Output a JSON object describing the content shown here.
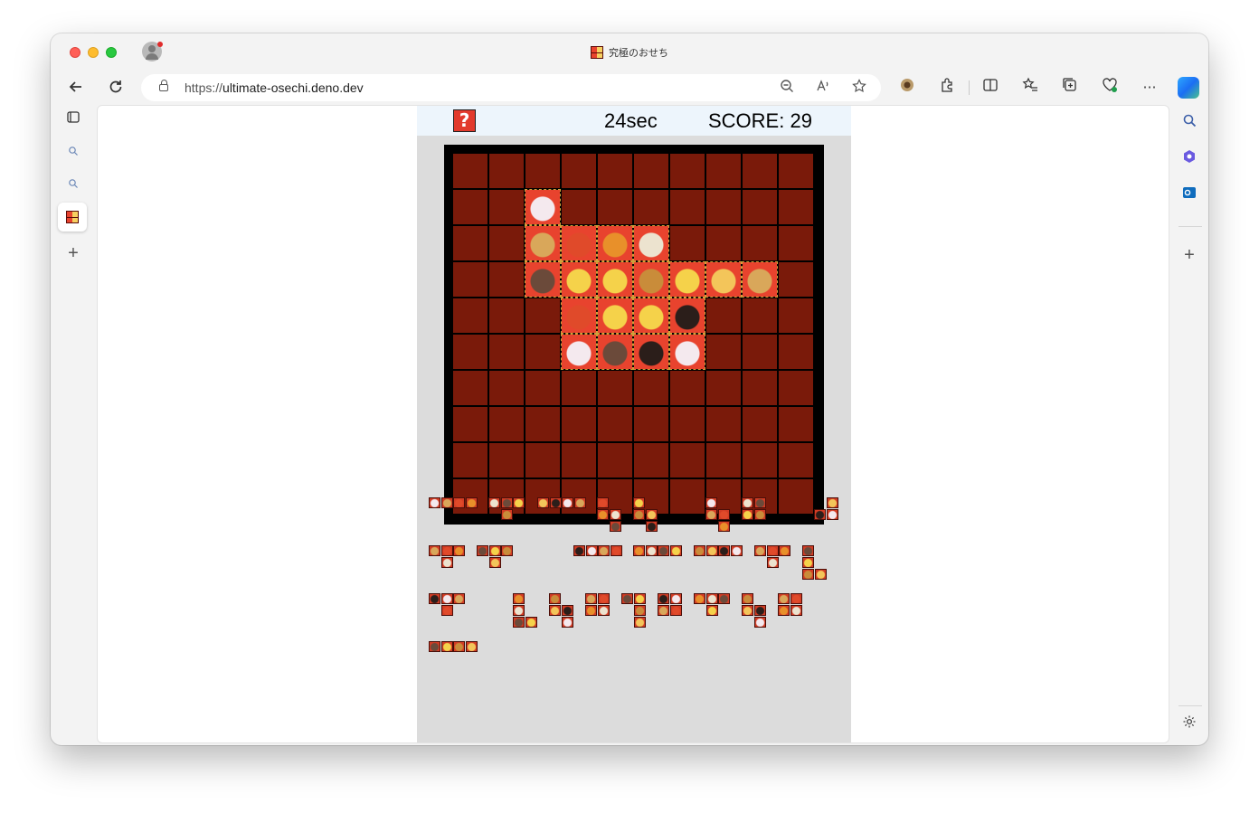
{
  "browser": {
    "tab_title": "究極のおせち",
    "url_scheme": "https://",
    "url_host": "ultimate-osechi.deno.dev"
  },
  "game": {
    "help_label": "?",
    "timer": "24sec",
    "score_label": "SCORE: 29",
    "board_size": 10,
    "board_color": "#7a1a0a",
    "board_pieces": [
      {
        "row": 1,
        "col": 2,
        "item": "kamaboko"
      },
      {
        "row": 2,
        "col": 2,
        "item": "datemaki"
      },
      {
        "row": 2,
        "col": 3,
        "item": "shrimp"
      },
      {
        "row": 2,
        "col": 4,
        "item": "kumquat"
      },
      {
        "row": 2,
        "col": 5,
        "item": "lotus-root"
      },
      {
        "row": 3,
        "col": 2,
        "item": "herring"
      },
      {
        "row": 3,
        "col": 3,
        "item": "tamago"
      },
      {
        "row": 3,
        "col": 4,
        "item": "tamago"
      },
      {
        "row": 3,
        "col": 5,
        "item": "kuri"
      },
      {
        "row": 3,
        "col": 6,
        "item": "tamago"
      },
      {
        "row": 3,
        "col": 7,
        "item": "kuri-kinton"
      },
      {
        "row": 3,
        "col": 8,
        "item": "datemaki"
      },
      {
        "row": 4,
        "col": 3,
        "item": "shrimp"
      },
      {
        "row": 4,
        "col": 4,
        "item": "tamago"
      },
      {
        "row": 4,
        "col": 5,
        "item": "tamago"
      },
      {
        "row": 4,
        "col": 6,
        "item": "kuromame"
      },
      {
        "row": 5,
        "col": 3,
        "item": "kamaboko"
      },
      {
        "row": 5,
        "col": 4,
        "item": "herring"
      },
      {
        "row": 5,
        "col": 5,
        "item": "kuromame"
      },
      {
        "row": 5,
        "col": 6,
        "item": "kamaboko"
      }
    ],
    "item_colors": {
      "kamaboko": "#f4e9ee",
      "datemaki": "#d9a75a",
      "shrimp": "#e04a2a",
      "kumquat": "#e8902a",
      "lotus-root": "#ece3cf",
      "herring": "#6b4a3a",
      "tamago": "#f5d24a",
      "kuri": "#c98c3a",
      "kuri-kinton": "#f3c55a",
      "kuromame": "#2b1e1a"
    }
  }
}
